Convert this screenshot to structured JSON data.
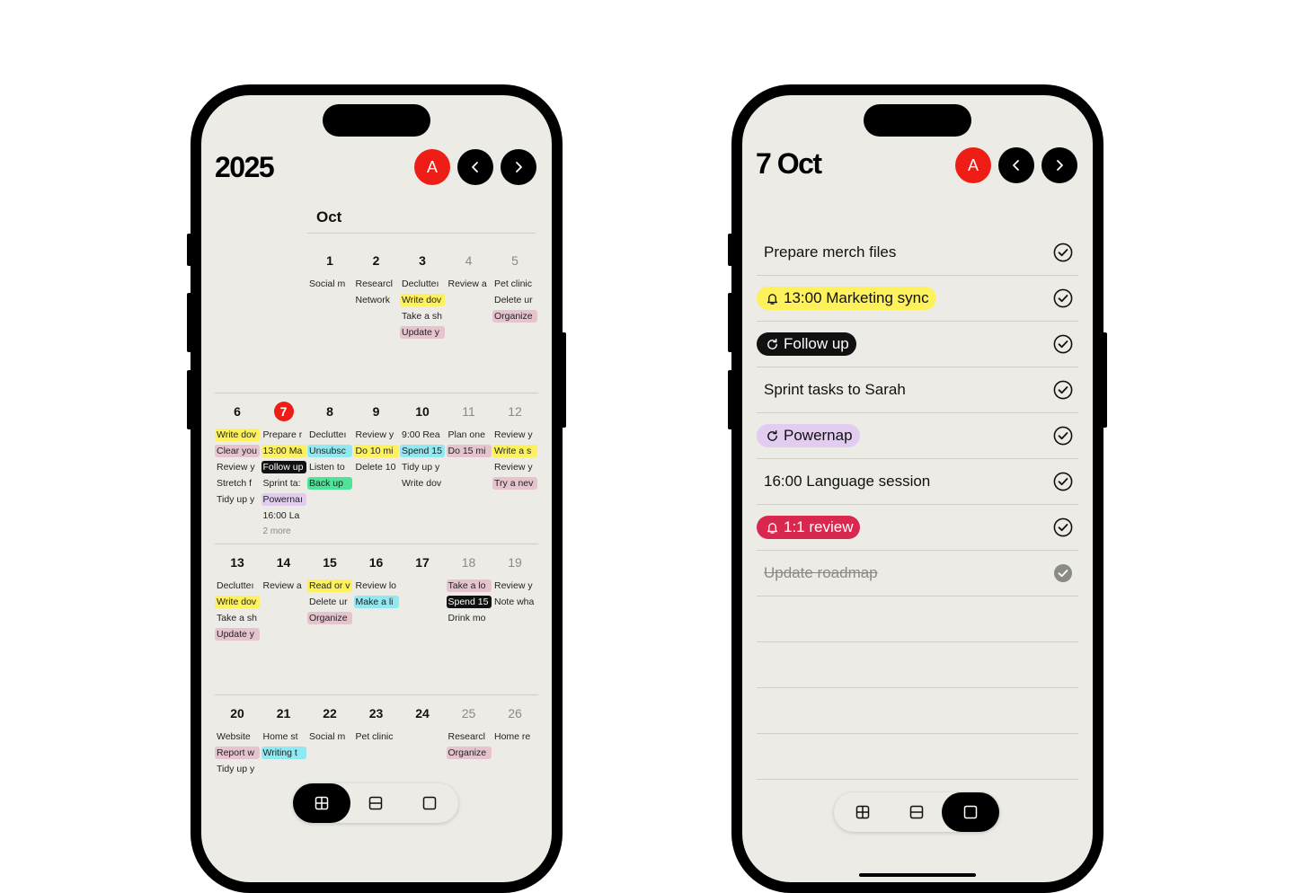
{
  "left_phone": {
    "title": "2025",
    "avatar_label": "A",
    "prev_icon": "chevron-left-icon",
    "next_icon": "chevron-right-icon",
    "month": "Oct",
    "weeks": [
      {
        "days": [
          {
            "num": "1",
            "events": [
              {
                "text": "Social m",
                "color": "none"
              }
            ]
          },
          {
            "num": "2",
            "events": [
              {
                "text": "Researcl",
                "color": "none"
              },
              {
                "text": "Network",
                "color": "none"
              }
            ]
          },
          {
            "num": "3",
            "events": [
              {
                "text": "Declutteı",
                "color": "none"
              },
              {
                "text": "Write dov",
                "color": "yellow"
              },
              {
                "text": "Take a sh",
                "color": "none"
              },
              {
                "text": "Update y",
                "color": "pink"
              }
            ]
          },
          {
            "num": "4",
            "weekend": true,
            "events": [
              {
                "text": "Review a",
                "color": "none"
              }
            ]
          },
          {
            "num": "5",
            "weekend": true,
            "events": [
              {
                "text": "Pet clinic",
                "color": "none"
              },
              {
                "text": "Delete ur",
                "color": "none"
              },
              {
                "text": "Organize",
                "color": "pink"
              }
            ]
          }
        ]
      },
      {
        "days": [
          {
            "num": "6",
            "events": [
              {
                "text": "Write dov",
                "color": "yellow"
              },
              {
                "text": "Clear you",
                "color": "pink"
              },
              {
                "text": "Review y",
                "color": "none"
              },
              {
                "text": "Stretch f",
                "color": "none"
              },
              {
                "text": "Tidy up y",
                "color": "none"
              }
            ]
          },
          {
            "num": "7",
            "today": true,
            "events": [
              {
                "text": "Prepare r",
                "color": "none"
              },
              {
                "text": "13:00 Ma",
                "color": "yellow"
              },
              {
                "text": "Follow up",
                "color": "black"
              },
              {
                "text": "Sprint ta:",
                "color": "none"
              },
              {
                "text": "Powernaı",
                "color": "purple"
              },
              {
                "text": "16:00 La",
                "color": "none"
              },
              {
                "text": "2 more",
                "color": "more"
              }
            ]
          },
          {
            "num": "8",
            "events": [
              {
                "text": "Declutteı",
                "color": "none"
              },
              {
                "text": "Unsubsc",
                "color": "cyan"
              },
              {
                "text": "Listen to",
                "color": "none"
              },
              {
                "text": "Back up",
                "color": "green"
              }
            ]
          },
          {
            "num": "9",
            "events": [
              {
                "text": "Review y",
                "color": "none"
              },
              {
                "text": "Do 10 mi",
                "color": "yellow"
              },
              {
                "text": "Delete 10",
                "color": "none"
              }
            ]
          },
          {
            "num": "10",
            "events": [
              {
                "text": "9:00 Rea",
                "color": "none"
              },
              {
                "text": "Spend 15",
                "color": "cyan"
              },
              {
                "text": "Tidy up y",
                "color": "none"
              },
              {
                "text": "Write dov",
                "color": "none"
              }
            ]
          },
          {
            "num": "11",
            "weekend": true,
            "events": [
              {
                "text": "Plan one",
                "color": "none"
              },
              {
                "text": "Do 15 mi",
                "color": "pink"
              }
            ]
          },
          {
            "num": "12",
            "weekend": true,
            "events": [
              {
                "text": "Review y",
                "color": "none"
              },
              {
                "text": "Write a s",
                "color": "yellow"
              },
              {
                "text": "Review y",
                "color": "none"
              },
              {
                "text": "Try a nev",
                "color": "pink"
              }
            ]
          }
        ]
      },
      {
        "days": [
          {
            "num": "13",
            "events": [
              {
                "text": "Declutteı",
                "color": "none"
              },
              {
                "text": "Write dov",
                "color": "yellow"
              },
              {
                "text": "Take a sh",
                "color": "none"
              },
              {
                "text": "Update y",
                "color": "pink"
              }
            ]
          },
          {
            "num": "14",
            "events": [
              {
                "text": "Review a",
                "color": "none"
              }
            ]
          },
          {
            "num": "15",
            "events": [
              {
                "text": "Read or v",
                "color": "yellow"
              },
              {
                "text": "Delete ur",
                "color": "none"
              },
              {
                "text": "Organize",
                "color": "pink"
              }
            ]
          },
          {
            "num": "16",
            "events": [
              {
                "text": "Review lo",
                "color": "none"
              },
              {
                "text": "Make a li",
                "color": "cyan"
              }
            ]
          },
          {
            "num": "17",
            "events": []
          },
          {
            "num": "18",
            "weekend": true,
            "events": [
              {
                "text": "Take a lo",
                "color": "pink"
              },
              {
                "text": "Spend 15",
                "color": "black"
              },
              {
                "text": "Drink mo",
                "color": "none"
              }
            ]
          },
          {
            "num": "19",
            "weekend": true,
            "events": [
              {
                "text": "Review y",
                "color": "none"
              },
              {
                "text": "Note wha",
                "color": "none"
              }
            ]
          }
        ]
      },
      {
        "days": [
          {
            "num": "20",
            "events": [
              {
                "text": "Website",
                "color": "none"
              },
              {
                "text": "Report w",
                "color": "pink"
              },
              {
                "text": "Tidy up y",
                "color": "none"
              }
            ]
          },
          {
            "num": "21",
            "events": [
              {
                "text": "Home st",
                "color": "none"
              },
              {
                "text": "Writing t",
                "color": "cyan"
              }
            ]
          },
          {
            "num": "22",
            "events": [
              {
                "text": "Social m",
                "color": "none"
              }
            ]
          },
          {
            "num": "23",
            "events": [
              {
                "text": "Pet clinic",
                "color": "none"
              }
            ]
          },
          {
            "num": "24",
            "events": []
          },
          {
            "num": "25",
            "weekend": true,
            "events": [
              {
                "text": "Researcl",
                "color": "none"
              },
              {
                "text": "Organize",
                "color": "pink"
              }
            ]
          },
          {
            "num": "26",
            "weekend": true,
            "events": [
              {
                "text": "Home re",
                "color": "none"
              }
            ]
          }
        ]
      }
    ],
    "view_modes": [
      {
        "icon": "month-grid-icon",
        "active": true
      },
      {
        "icon": "week-rows-icon",
        "active": false
      },
      {
        "icon": "day-square-icon",
        "active": false
      }
    ]
  },
  "right_phone": {
    "title": "7 Oct",
    "avatar_label": "A",
    "tasks": [
      {
        "text": "Prepare merch files",
        "style": "plain",
        "done": false
      },
      {
        "text": "13:00 Marketing sync",
        "style": "yellow",
        "icon": "bell-icon",
        "done": false
      },
      {
        "text": "Follow up",
        "style": "black",
        "icon": "repeat-icon",
        "done": false
      },
      {
        "text": "Sprint tasks to Sarah",
        "style": "plain",
        "done": false
      },
      {
        "text": "Powernap",
        "style": "purple",
        "icon": "repeat-icon",
        "done": false
      },
      {
        "text": "16:00 Language session",
        "style": "plain",
        "done": false
      },
      {
        "text": "1:1 review",
        "style": "red",
        "icon": "bell-icon",
        "done": false
      },
      {
        "text": "Update roadmap",
        "style": "plain",
        "done": true
      }
    ],
    "empty_rows": 4,
    "view_modes": [
      {
        "icon": "month-grid-icon",
        "active": false
      },
      {
        "icon": "week-rows-icon",
        "active": false
      },
      {
        "icon": "day-square-icon",
        "active": true
      }
    ]
  },
  "colors": {
    "accent_red": "#ee1d16",
    "screen_bg": "#ecebe6",
    "yellow": "#fdf25c",
    "pink": "#e6c4cf",
    "purple": "#e2cdf0",
    "cyan": "#8fe8f2",
    "green": "#4fe39a",
    "review_red": "#d8284f"
  }
}
